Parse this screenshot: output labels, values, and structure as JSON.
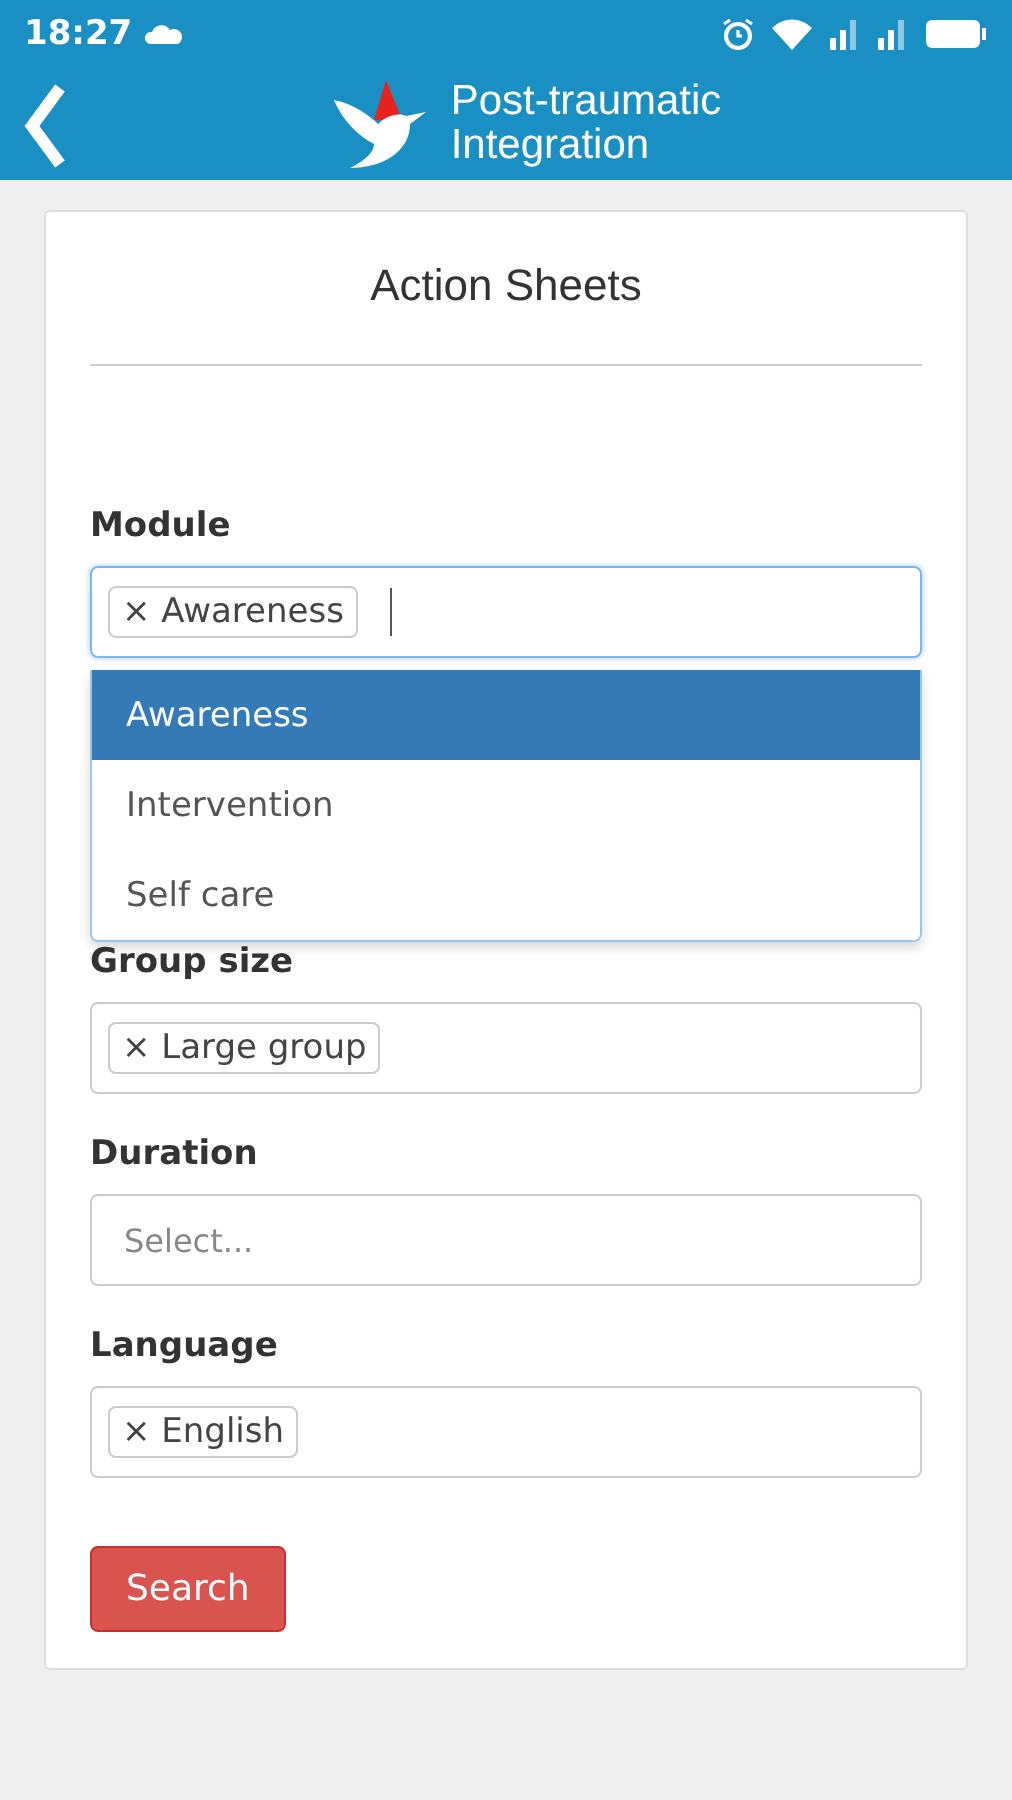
{
  "status_bar": {
    "time": "18:27"
  },
  "header": {
    "title_lines": [
      "Post-traumatic",
      "Integration"
    ]
  },
  "card": {
    "title": "Action Sheets"
  },
  "filters": [
    {
      "label": "Module",
      "tags": [
        "× Awareness"
      ],
      "focused": true,
      "dropdown": [
        {
          "label": "Awareness",
          "selected": true
        },
        {
          "label": "Intervention",
          "selected": false
        },
        {
          "label": "Self care",
          "selected": false
        }
      ]
    },
    {
      "label": "Group size",
      "tags": [
        "× Large group"
      ],
      "focused": false
    },
    {
      "label": "Duration",
      "placeholder": "Select...",
      "focused": false
    },
    {
      "label": "Language",
      "tags": [
        "× English"
      ],
      "focused": false
    }
  ],
  "search_button": "Search"
}
